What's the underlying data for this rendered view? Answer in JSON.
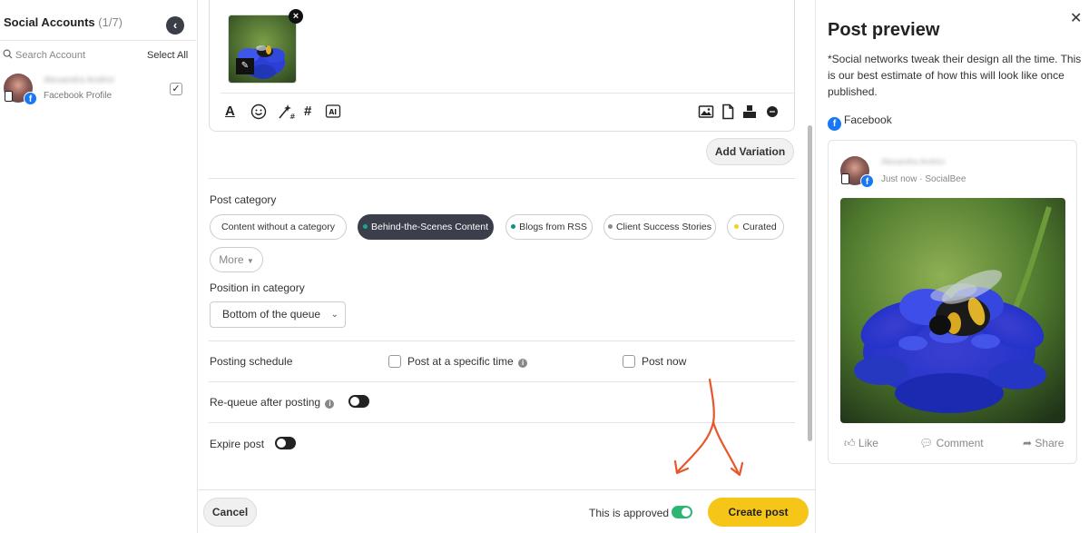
{
  "sidebar": {
    "title": "Social Accounts",
    "count": "(1/7)",
    "search_placeholder": "Search Account",
    "select_all": "Select All",
    "accounts": [
      {
        "name": "Alexandra Andrici",
        "type": "Facebook Profile",
        "checked": true
      }
    ]
  },
  "editor": {
    "toolbar_left": [
      "text-format-icon",
      "emoji-icon",
      "magic-hashtag-icon",
      "hashtag-icon",
      "ai-icon"
    ],
    "toolbar_right": [
      "image-icon",
      "document-icon",
      "stamp-icon",
      "more-circle-icon"
    ],
    "add_variation": "Add Variation"
  },
  "post_category": {
    "label": "Post category",
    "categories": [
      {
        "label": "Content without a category",
        "color": null,
        "active": false
      },
      {
        "label": "Behind-the-Scenes Content",
        "color": "#1aa59a",
        "active": true
      },
      {
        "label": "Blogs from RSS",
        "color": "#0f8f85",
        "active": false
      },
      {
        "label": "Client Success Stories",
        "color": "#8a8a8a",
        "active": false
      },
      {
        "label": "Curated",
        "color": "#f2d21b",
        "active": false
      }
    ],
    "more": "More"
  },
  "position": {
    "label": "Position in category",
    "value": "Bottom of the queue"
  },
  "schedule": {
    "label": "Posting schedule",
    "specific_time": "Post at a specific time",
    "post_now": "Post now"
  },
  "requeue": {
    "label": "Re-queue after posting"
  },
  "expire": {
    "label": "Expire post"
  },
  "footer": {
    "cancel": "Cancel",
    "approved": "This is approved",
    "create": "Create post"
  },
  "preview": {
    "title": "Post preview",
    "note": "*Social networks tweak their design all the time. This is our best estimate of how this will look like once published.",
    "network": "Facebook",
    "name": "Alexandra Andrici",
    "time": "Just now · SocialBee",
    "actions": [
      "Like",
      "Comment",
      "Share"
    ]
  },
  "colors": {
    "accent_yellow": "#f5c518",
    "facebook_blue": "#1877f2",
    "toggle_on": "#2bb673",
    "annotation_arrow": "#e8572a"
  }
}
